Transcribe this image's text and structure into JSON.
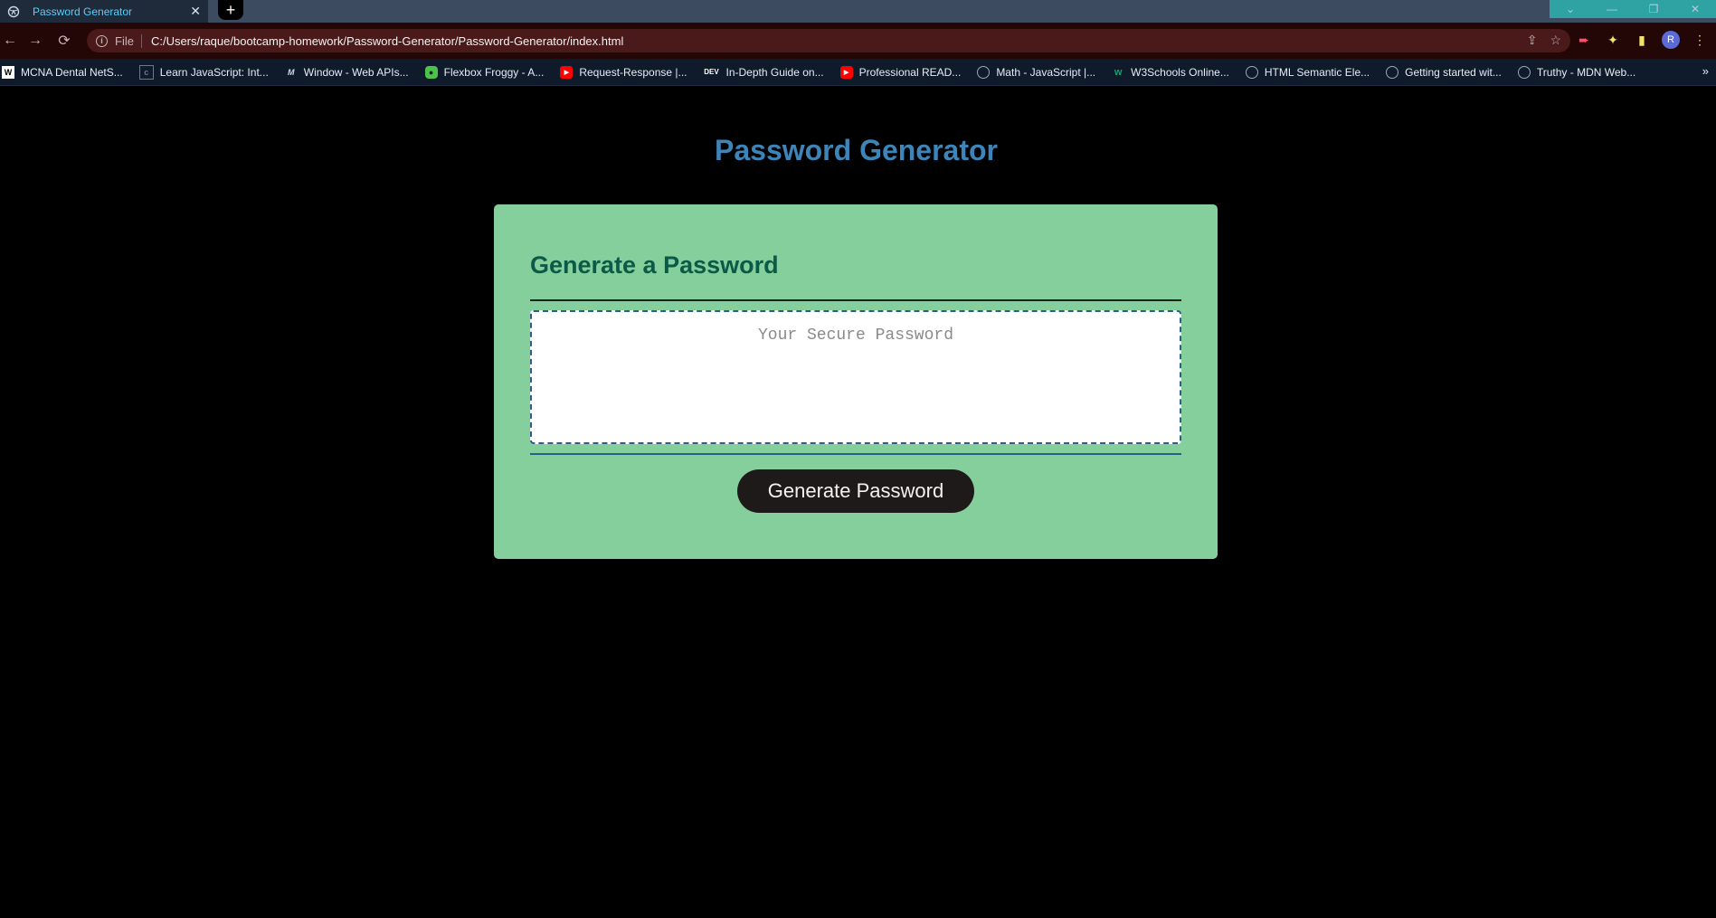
{
  "browser": {
    "tab": {
      "title": "Password Generator",
      "close": "✕"
    },
    "new_tab": "+",
    "window_controls": [
      "⌄",
      "—",
      "❐",
      "✕"
    ],
    "address": {
      "scheme_label": "File",
      "url": "C:/Users/raque/bootcamp-homework/Password-Generator/Password-Generator/index.html"
    },
    "profile_initial": "R",
    "bookmarks": [
      {
        "label": "MCNA Dental NetS...",
        "icon": "mcna-icon"
      },
      {
        "label": "Learn JavaScript: Int...",
        "icon": "page-icon"
      },
      {
        "label": "Window - Web APIs...",
        "icon": "mdn-icon"
      },
      {
        "label": "Flexbox Froggy - A...",
        "icon": "frog-icon"
      },
      {
        "label": "Request-Response |...",
        "icon": "youtube-icon"
      },
      {
        "label": "In-Depth Guide on...",
        "icon": "dev-icon"
      },
      {
        "label": "Professional READ...",
        "icon": "youtube-icon"
      },
      {
        "label": "Math - JavaScript |...",
        "icon": "globe-icon"
      },
      {
        "label": "W3Schools Online...",
        "icon": "w3schools-icon"
      },
      {
        "label": "HTML Semantic Ele...",
        "icon": "globe-icon"
      },
      {
        "label": "Getting started wit...",
        "icon": "globe-icon"
      },
      {
        "label": "Truthy - MDN Web...",
        "icon": "globe-icon"
      }
    ],
    "bookmarks_more": "»",
    "colors": {
      "tabstrip": "#3d4b61",
      "toolbar": "#230707",
      "bookmarks_bar": "#0f1a2b"
    }
  },
  "page": {
    "title": "Password Generator",
    "card": {
      "header": "Generate a Password",
      "password_placeholder": "Your Secure Password",
      "password_value": "",
      "button_label": "Generate Password"
    },
    "colors": {
      "background": "#000000",
      "title": "#3d84b8",
      "card": "#84cf9c",
      "header": "#0b5a47",
      "button": "#1f1a1a"
    }
  }
}
